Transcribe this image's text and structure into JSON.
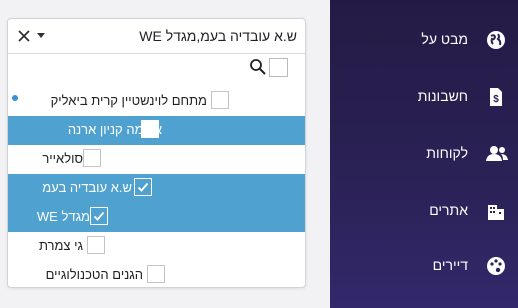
{
  "dropdown": {
    "selected_text": "ש.א עובדיה בעמ,מגדל WE",
    "items": [
      {
        "label": "מתחם לוינשטיין קרית ביאליק",
        "selected": false
      },
      {
        "label": "ארומה קניון ארנה",
        "selected": false
      },
      {
        "label": "סולאייר",
        "selected": false
      },
      {
        "label": "ש.א עובדיה בעמ",
        "selected": true
      },
      {
        "label": "מגדל WE",
        "selected": true
      },
      {
        "label": "גי צמרת",
        "selected": false
      },
      {
        "label": "הגנים הטכנולוגיים",
        "selected": false
      }
    ]
  },
  "sidebar": {
    "items": [
      {
        "label": "מבט על",
        "icon": "globe-icon"
      },
      {
        "label": "חשבונות",
        "icon": "invoice-icon"
      },
      {
        "label": "לקוחות",
        "icon": "users-icon"
      },
      {
        "label": "אתרים",
        "icon": "building-icon"
      },
      {
        "label": "דיירים",
        "icon": "palette-icon"
      }
    ]
  },
  "colors": {
    "selected_row": "#4fa1cf",
    "sidebar_bg": "#241b45",
    "accent_dot": "#3c8fd0"
  }
}
